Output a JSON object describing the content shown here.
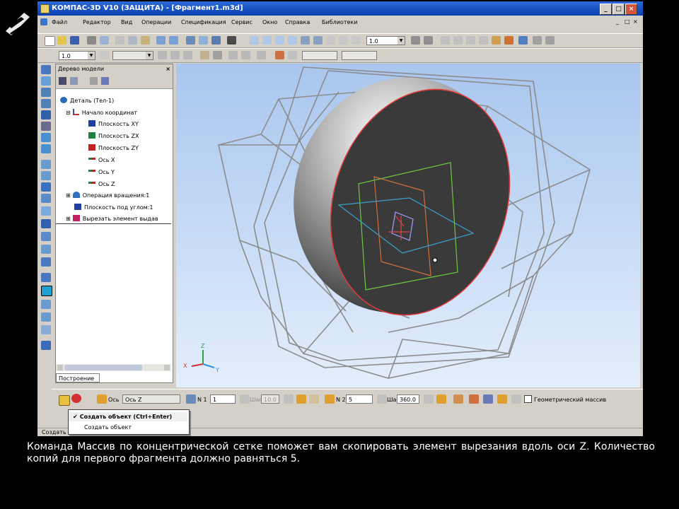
{
  "window": {
    "title": "КОМПАС-3D V10 (ЗАЩИТА) - [Фрагмент1.m3d]",
    "controls": [
      "_",
      "□",
      "×"
    ]
  },
  "menu": [
    "Файл",
    "Редактор",
    "Вид",
    "Операции",
    "Спецификация",
    "Сервис",
    "Окно",
    "Справка",
    "Библиотеки"
  ],
  "toolbar": {
    "zoom_value": "1.0",
    "step_value": "1.0"
  },
  "tree": {
    "title": "Дерево модели",
    "close": "×",
    "nodes": [
      {
        "label": "Деталь (Тел-1)",
        "icon": "part-icon"
      },
      {
        "label": "Начало координат",
        "icon": "origin-icon"
      },
      {
        "label": "Плоскость XY",
        "icon": "plane-xy-icon"
      },
      {
        "label": "Плоскость ZX",
        "icon": "plane-zx-icon"
      },
      {
        "label": "Плоскость ZY",
        "icon": "plane-zy-icon"
      },
      {
        "label": "Ось X",
        "icon": "axis-icon"
      },
      {
        "label": "Ось Y",
        "icon": "axis-icon"
      },
      {
        "label": "Ось Z",
        "icon": "axis-icon"
      },
      {
        "label": "Операция вращения:1",
        "icon": "revolve-icon"
      },
      {
        "label": "Плоскость под углом:1",
        "icon": "angled-plane-icon"
      },
      {
        "label": "Вырезать элемент выдав",
        "icon": "cut-extrude-icon"
      }
    ],
    "tab": "Построение"
  },
  "props": {
    "axis_label": "Ось",
    "axis_value": "Ось Z",
    "n1_label": "N 1",
    "n1_value": "1",
    "step1_label": "Шаг 1",
    "step1_value": "10.0",
    "n2_label": "N 2",
    "n2_value": "5",
    "step2_label": "Шаг 2",
    "step2_value": "360.0",
    "geometric_label": "Геометрический массив"
  },
  "popup": {
    "item1": "Создать объект (Ctrl+Enter)",
    "item2": "Создать объект"
  },
  "status": {
    "text": "Создать объект"
  },
  "axes_labels": {
    "x": "X",
    "y": "Y",
    "z": "Z"
  },
  "caption": "Команда Массив по концентрической сетке поможет вам скопировать элемент вырезания вдоль оси Z. Количество копий для первого фрагмента должно равняться 5."
}
